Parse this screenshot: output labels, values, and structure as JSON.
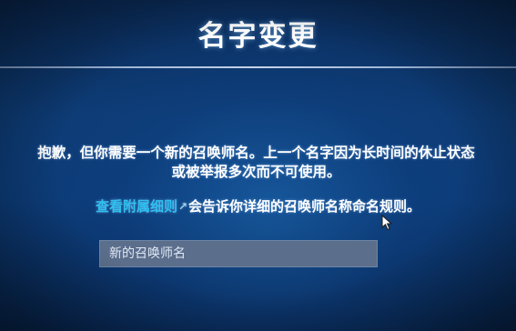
{
  "dialog": {
    "title": "名字变更",
    "message_lines": [
      "抱歉，但你需要一个新的召唤师名。上一个名字因为长时间的休止状态",
      "或被举报多次而不可使用。"
    ],
    "rules_link_label": "查看附属细则",
    "rules_suffix": "会告诉你详细的召唤师名称命名规则。",
    "name_input": {
      "placeholder": "新的召唤师名",
      "value": ""
    }
  },
  "icons": {
    "external_link": "external-link-icon",
    "cursor": "mouse-pointer-icon"
  },
  "colors": {
    "background": "#0c3a75",
    "title_text": "#ffffff",
    "link": "#2fc0f0",
    "input_background": "#5b6e8b",
    "input_border": "#6d86a6"
  }
}
